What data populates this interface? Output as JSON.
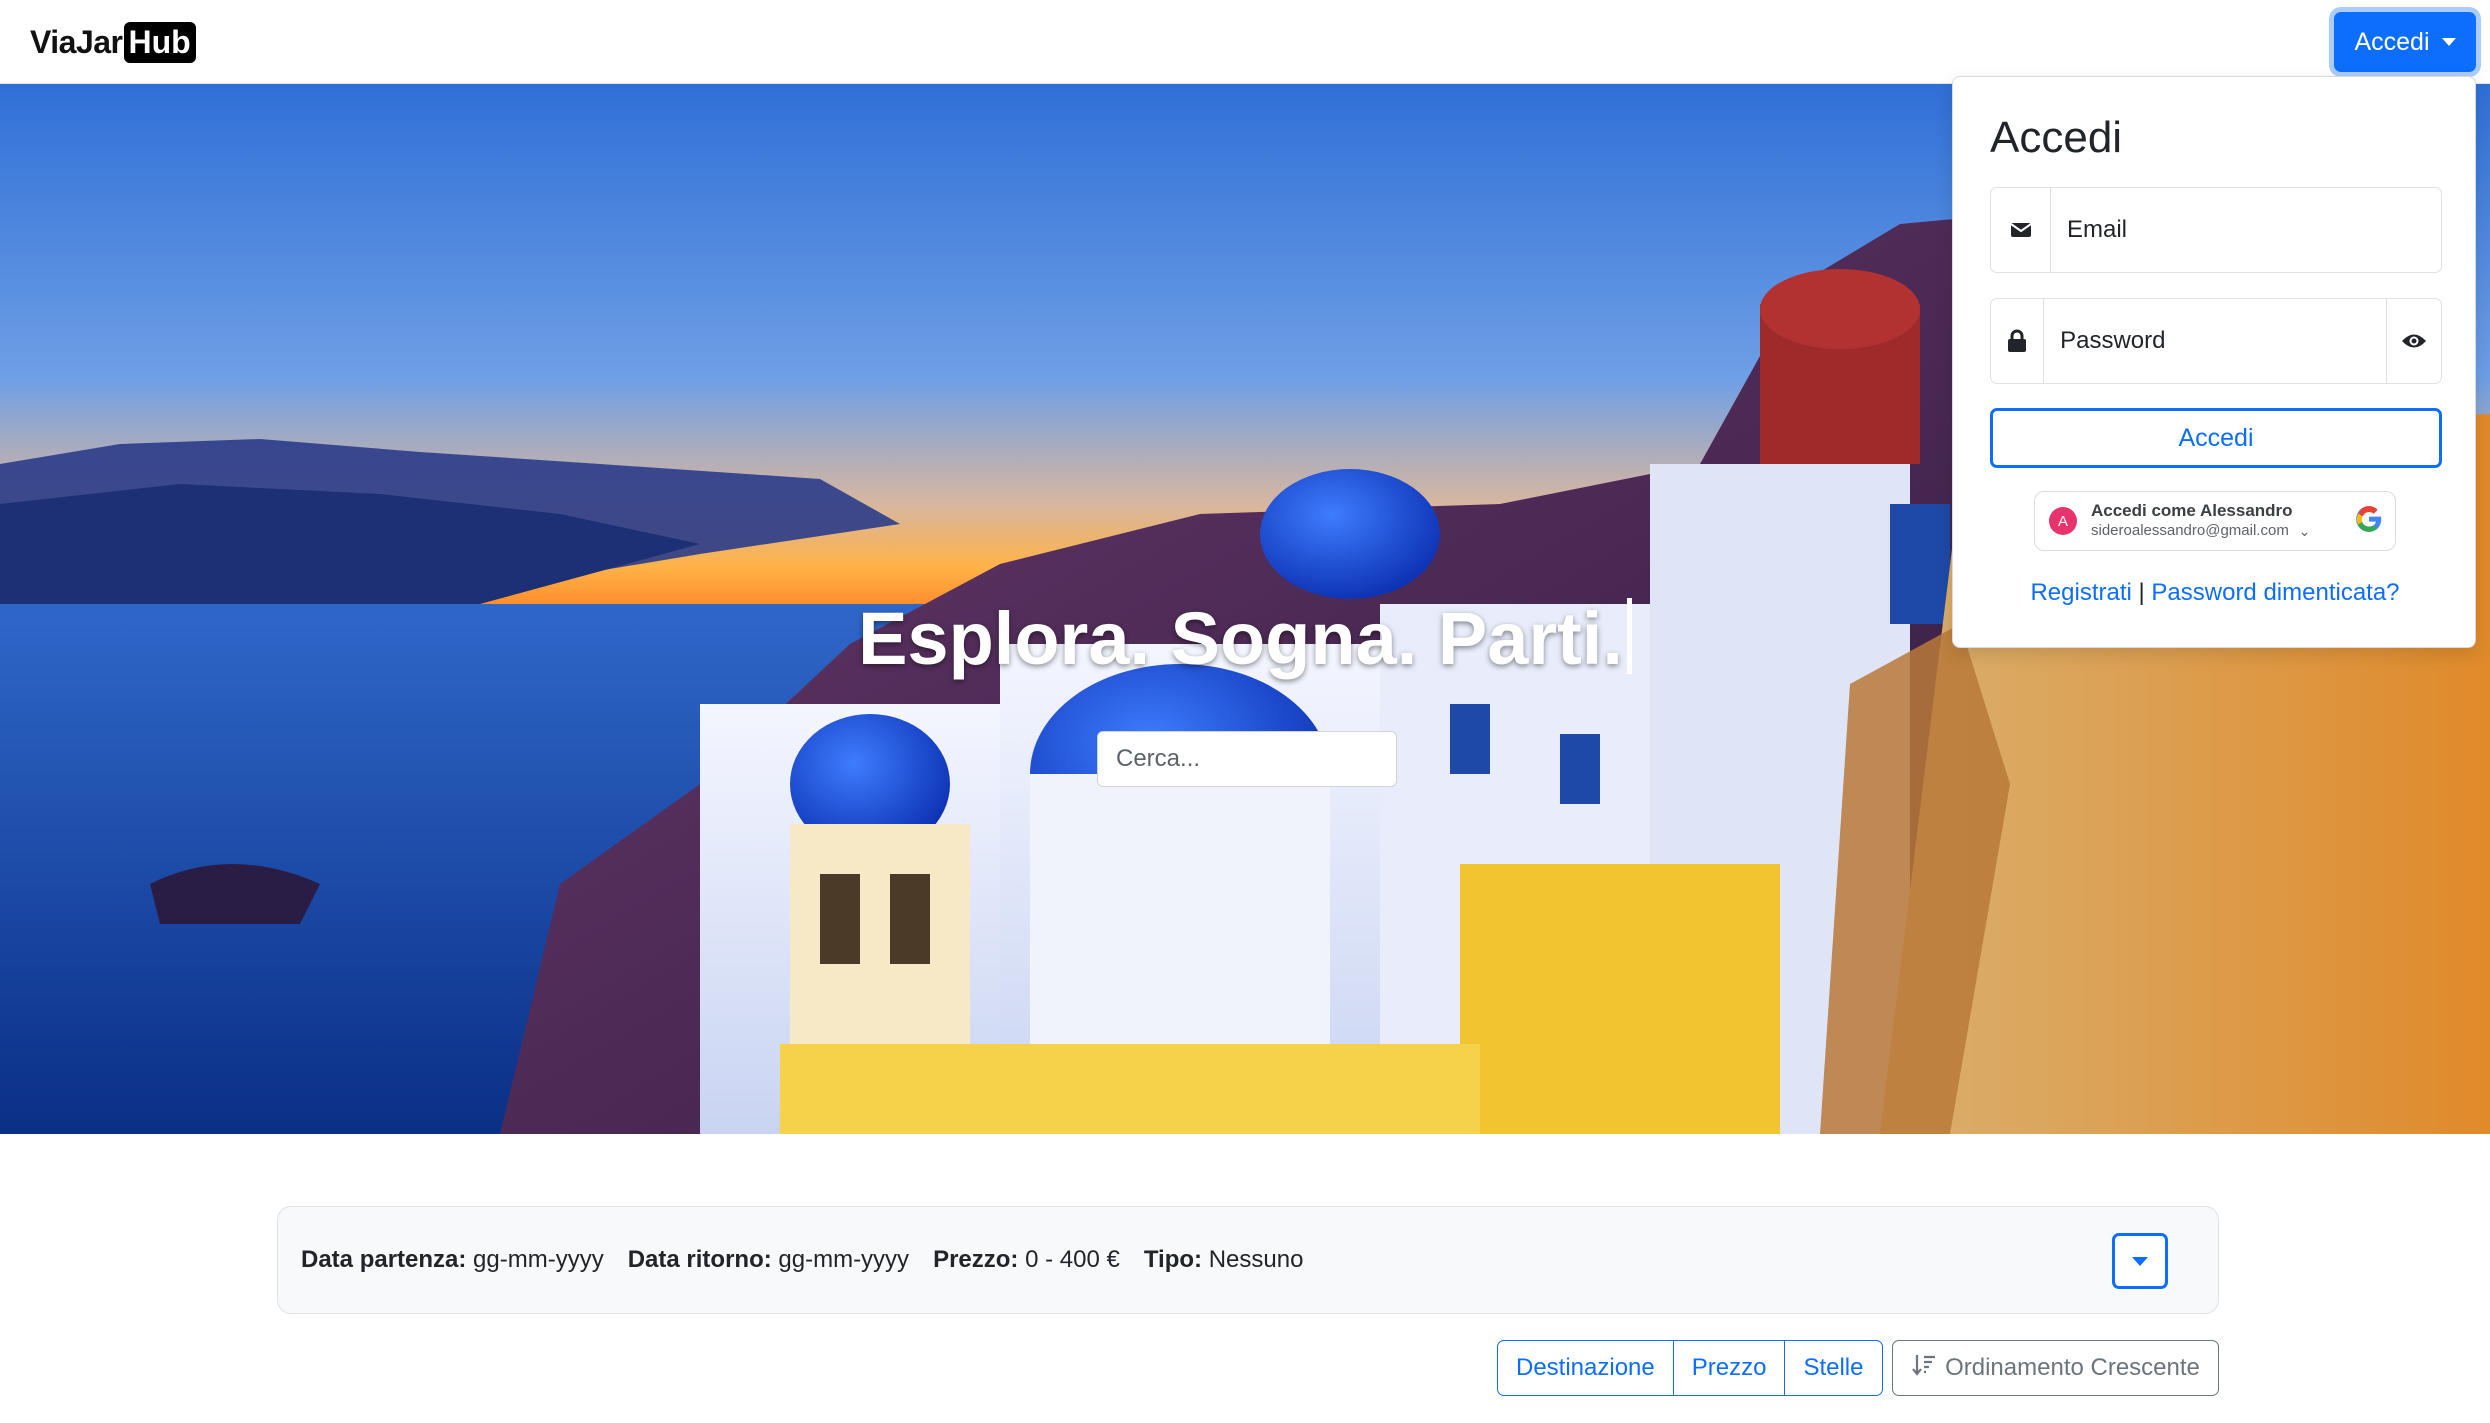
{
  "brand": {
    "name_main": "ViaJar",
    "name_badge": "Hub"
  },
  "navbar": {
    "login_toggle_label": "Accedi"
  },
  "hero": {
    "title": "Esplora. Sogna. Parti.",
    "search_placeholder": "Cerca...",
    "search_value": ""
  },
  "login_dropdown": {
    "title": "Accedi",
    "email_placeholder": "Email",
    "password_placeholder": "Password",
    "submit_label": "Accedi",
    "google": {
      "line1": "Accedi come Alessandro",
      "line2": "sideroalessandro@gmail.com",
      "avatar_letter": "A"
    },
    "register_link": "Registrati",
    "separator": "|",
    "forgot_link": "Password dimenticata?"
  },
  "filters": {
    "departure": {
      "label": "Data partenza:",
      "value": "gg-mm-yyyy"
    },
    "return": {
      "label": "Data ritorno:",
      "value": "gg-mm-yyyy"
    },
    "price": {
      "label": "Prezzo:",
      "value": "0 - 400 €"
    },
    "type": {
      "label": "Tipo:",
      "value": "Nessuno"
    }
  },
  "sort": {
    "options": [
      "Destinazione",
      "Prezzo",
      "Stelle"
    ],
    "order_label": "Ordinamento Crescente"
  },
  "icons": {
    "email": "envelope-icon",
    "password": "lock-icon",
    "show_password": "eye-icon",
    "google": "google-logo-icon",
    "filter_toggle": "caret-down-icon",
    "order": "sort-descending-icon"
  },
  "colors": {
    "primary": "#0d6efd",
    "secondary": "#6c757d",
    "filter_bg": "#f8f9fa",
    "google_avatar": "#e8336c"
  }
}
